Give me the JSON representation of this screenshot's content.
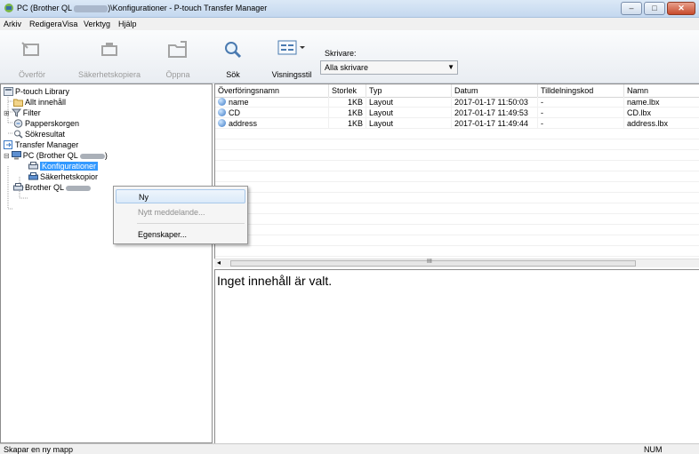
{
  "window": {
    "title_prefix": "PC (Brother QL ",
    "title_suffix": ")\\Konfigurationer - P-touch Transfer Manager",
    "controls": {
      "minimize": "–",
      "maximize": "□",
      "close": "✕"
    }
  },
  "menu": [
    "Arkiv",
    "Redigera",
    "Visa",
    "Verktyg",
    "Hjälp"
  ],
  "toolbar": {
    "transfer": "Överför",
    "backup": "Säkerhetskopiera",
    "open": "Öppna",
    "search": "Sök",
    "view_style": "Visningsstil",
    "printer_label": "Skrivare:",
    "printer_value": "Alla skrivare",
    "dropdown_arrow": "▼"
  },
  "tree": {
    "library": "P-touch Library",
    "all_content": "Allt innehåll",
    "filter": "Filter",
    "trash": "Papperskorgen",
    "search_results": "Sökresultat",
    "transfer_manager": "Transfer Manager",
    "pc_prefix": "PC (Brother QL ",
    "pc_suffix": ")",
    "configurations": "Konfigurationer",
    "backups": "Säkerhetskopior",
    "brother": "Brother QL"
  },
  "columns": [
    "Överföringsnamn",
    "Storlek",
    "Typ",
    "Datum",
    "Tilldelningskod",
    "Namn"
  ],
  "rows": [
    {
      "name": "name",
      "size": "1KB",
      "type": "Layout",
      "date": "2017-01-17 11:50:03",
      "code": "-",
      "file": "name.lbx"
    },
    {
      "name": "CD",
      "size": "1KB",
      "type": "Layout",
      "date": "2017-01-17 11:49:53",
      "code": "-",
      "file": "CD.lbx"
    },
    {
      "name": "address",
      "size": "1KB",
      "type": "Layout",
      "date": "2017-01-17 11:49:44",
      "code": "-",
      "file": "address.lbx"
    }
  ],
  "scroll": {
    "left_arrow": "◂",
    "grip": "III"
  },
  "preview": {
    "empty_text": "Inget innehåll är valt."
  },
  "context_menu": {
    "new": "Ny",
    "new_message": "Nytt meddelande...",
    "properties": "Egenskaper..."
  },
  "status": {
    "message": "Skapar en ny mapp",
    "num": "NUM"
  },
  "colors": {
    "selection": "#3399ff",
    "titlebar": "#c4d8ef",
    "close_button": "#c74a2c"
  },
  "icons": [
    "app-icon",
    "transfer-icon",
    "backup-icon",
    "open-icon",
    "search-icon",
    "view-style-icon",
    "library-icon",
    "folder-icon",
    "filter-icon",
    "trash-icon",
    "search-results-icon",
    "transfer-manager-icon",
    "pc-icon",
    "printer-icon",
    "layout-file-icon"
  ]
}
